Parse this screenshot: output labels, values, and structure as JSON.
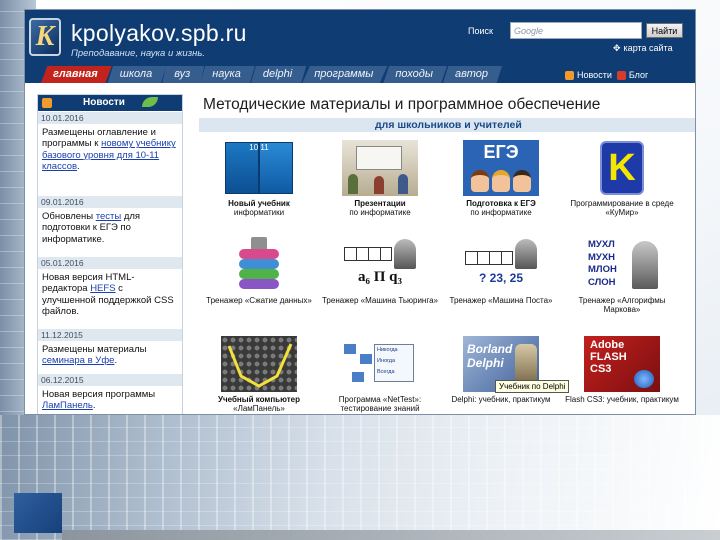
{
  "site": {
    "title": "kpolyakov.spb.ru",
    "tagline": "Преподавание, наука и жизнь.",
    "logo_letter": "K",
    "search": {
      "label": "Поиск",
      "placeholder": "Google",
      "button": "Найти"
    },
    "sitemap_link": "карта сайта",
    "nav_tabs": [
      "главная",
      "школа",
      "вуз",
      "наука",
      "delphi",
      "программы",
      "походы",
      "автор"
    ],
    "active_tab": "главная",
    "header_links": {
      "news": "Новости",
      "blog": "Блог"
    }
  },
  "news": {
    "header": "Новости",
    "items": [
      {
        "date": "10.01.2016",
        "before": "Размещены оглавление и программы к ",
        "link": "новому учебнику базового уровня для 10-11 классов",
        "after": "."
      },
      {
        "date": "09.01.2016",
        "before": "Обновлены ",
        "link": "тесты",
        "after": " для подготовки к ЕГЭ по информатике."
      },
      {
        "date": "05.01.2016",
        "before": "Новая версия HTML-редактора ",
        "link": "HEFS",
        "after": " с улучшенной поддержкой CSS файлов."
      },
      {
        "date": "11.12.2015",
        "before": "Размещены материалы ",
        "link": "семинара в Уфе",
        "after": "."
      },
      {
        "date": "06.12.2015",
        "before": "Новая версия программы ",
        "link": "ЛамПанель",
        "after": "."
      }
    ]
  },
  "main": {
    "title": "Методические материалы и программное обеспечение",
    "subtitle": "для школьников и учителей",
    "tiles": [
      {
        "line1": "Новый учебник",
        "line2": "информатики",
        "img_text": "10  11"
      },
      {
        "line1": "Презентации",
        "line2": "по информатике",
        "img_text": ""
      },
      {
        "line1": "Подготовка к ЕГЭ",
        "line2": "по информатике",
        "img_text": "ЕГЭ"
      },
      {
        "line1": "Программирование",
        "line2": "в среде «КуМир»",
        "img_text": "K"
      },
      {
        "line1": "Тренажер «Сжатие",
        "line2": "данных»",
        "img_text": ""
      },
      {
        "line1": "Тренажер «Машина",
        "line2": "Тьюринга»",
        "img_text": "a₆ П q₃"
      },
      {
        "line1": "Тренажер «Машина",
        "line2": "Поста»",
        "img_text": "? 23, 25"
      },
      {
        "line1": "Тренажер «Алгорифмы",
        "line2": "Маркова»",
        "img_text": "МУХЛ МУХН МЛОН СЛОН"
      },
      {
        "line1": "Учебный компьютер",
        "line2": "«ЛамПанель»",
        "img_text": ""
      },
      {
        "line1": "Программа «NetTest»:",
        "line2": "тестирование знаний",
        "img_text": "Никогда Иногда Всегда"
      },
      {
        "line1": "Delphi: учебник,",
        "line2": "практикум",
        "img_text": "Borland Delphi"
      },
      {
        "line1": "Flash CS3: учебник,",
        "line2": "практикум",
        "img_text": "Adobe FLASH CS3"
      }
    ],
    "tooltip": "Учебник по Delphi"
  },
  "colors": {
    "header_bg": "#0f3c73",
    "active_tab": "#c3231d",
    "tab": "#355d8e",
    "link": "#1a3fb0",
    "subtitle_bar": "#dbe6f0"
  }
}
